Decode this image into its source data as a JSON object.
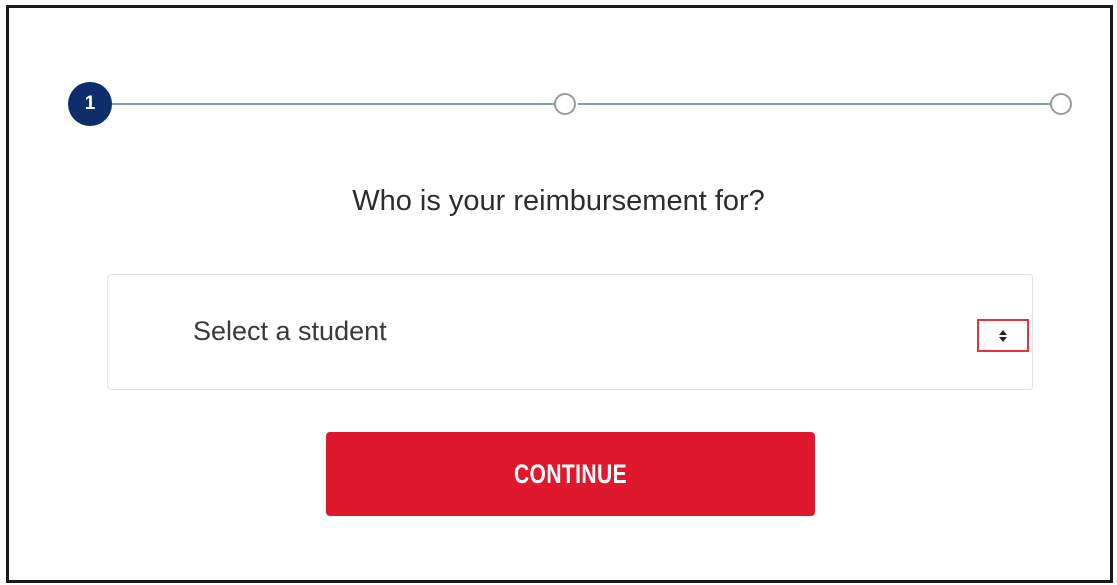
{
  "stepper": {
    "current_step_label": "1",
    "total_steps": 3,
    "current_step": 1,
    "active_color": "#0e2d6b",
    "line_color": "#7f99c4"
  },
  "form": {
    "question": "Who is your reimbursement for?",
    "student_select": {
      "selected_value": "Select a student",
      "icon": "sort-arrows-icon",
      "highlight_color": "#e8323c"
    },
    "continue_label": "CONTINUE",
    "continue_color": "#e0182d"
  }
}
